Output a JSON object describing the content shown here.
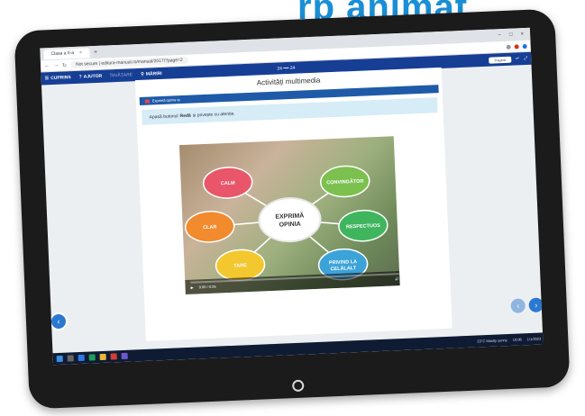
{
  "headline": "rp animat",
  "browser": {
    "tab_title": "Clasa a II-a",
    "tab_close": "×",
    "new_tab": "+",
    "window_controls": [
      "–",
      "□",
      "×"
    ],
    "url": "Not secure | editura-manual.ro/manual/2017/?page=2"
  },
  "toolbar": {
    "cuprins": "CUPRINS",
    "ajutor": "AJUTOR",
    "invatare": "ÎNVĂȚARE",
    "mariri": "MĂRIRI",
    "page_center": "24 ━━ 24",
    "page_input": "Pagina",
    "page_go": "↵"
  },
  "content": {
    "section_title": "Activități multimedia",
    "strip_label": "Exprimă opinia ta",
    "instruction_pre": "Apasă butonul",
    "instruction_bold": "Redă",
    "instruction_post": "și privește cu atenție."
  },
  "diagram": {
    "center": [
      "EXPRIMĂ",
      "OPINIA"
    ],
    "nodes": [
      {
        "label": "CALM",
        "color": "#e9566a"
      },
      {
        "label": "CONVINGĂTOR",
        "color": "#7cc04f"
      },
      {
        "label": "RESPECTUOS",
        "color": "#3fb55e"
      },
      {
        "label": "PRIVIND LA",
        "label2": "CELĂLALT",
        "color": "#3ca3d8"
      },
      {
        "label": "TARE",
        "color": "#f3c72e"
      },
      {
        "label": "CLAR",
        "color": "#f28a2e"
      }
    ]
  },
  "video": {
    "time": "0:00 / 0:26",
    "play_icon": "▶",
    "progress_fraction": 0.0
  },
  "nav": {
    "back_icon": "‹",
    "prev_icon": "‹",
    "next_icon": "›"
  },
  "taskbar": {
    "weather": "23°C  Mostly sunny",
    "time": "10:08",
    "date": "1/1/2023"
  }
}
